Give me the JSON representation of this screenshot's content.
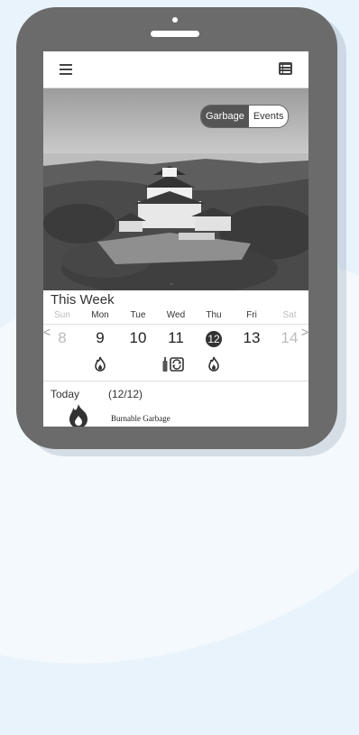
{
  "topbar": {
    "menu_icon": "hamburger-menu-icon",
    "list_icon": "list-view-icon"
  },
  "toggle": {
    "garbage_label": "Garbage",
    "events_label": "Events",
    "active": "Garbage"
  },
  "week": {
    "title": "This Week",
    "days": [
      "Sun",
      "Mon",
      "Tue",
      "Wed",
      "Thu",
      "Fri",
      "Sat"
    ],
    "dates": [
      "8",
      "9",
      "10",
      "11",
      "12",
      "13",
      "14"
    ],
    "today_index": 4,
    "prev_arrow": "<",
    "next_arrow": ">"
  },
  "today": {
    "label": "Today",
    "date": "(12/12)",
    "item": "Burnable Garbage"
  },
  "colors": {
    "frame": "#6b6b6b",
    "background": "#e9f3fb",
    "accent_dark": "#333333"
  }
}
